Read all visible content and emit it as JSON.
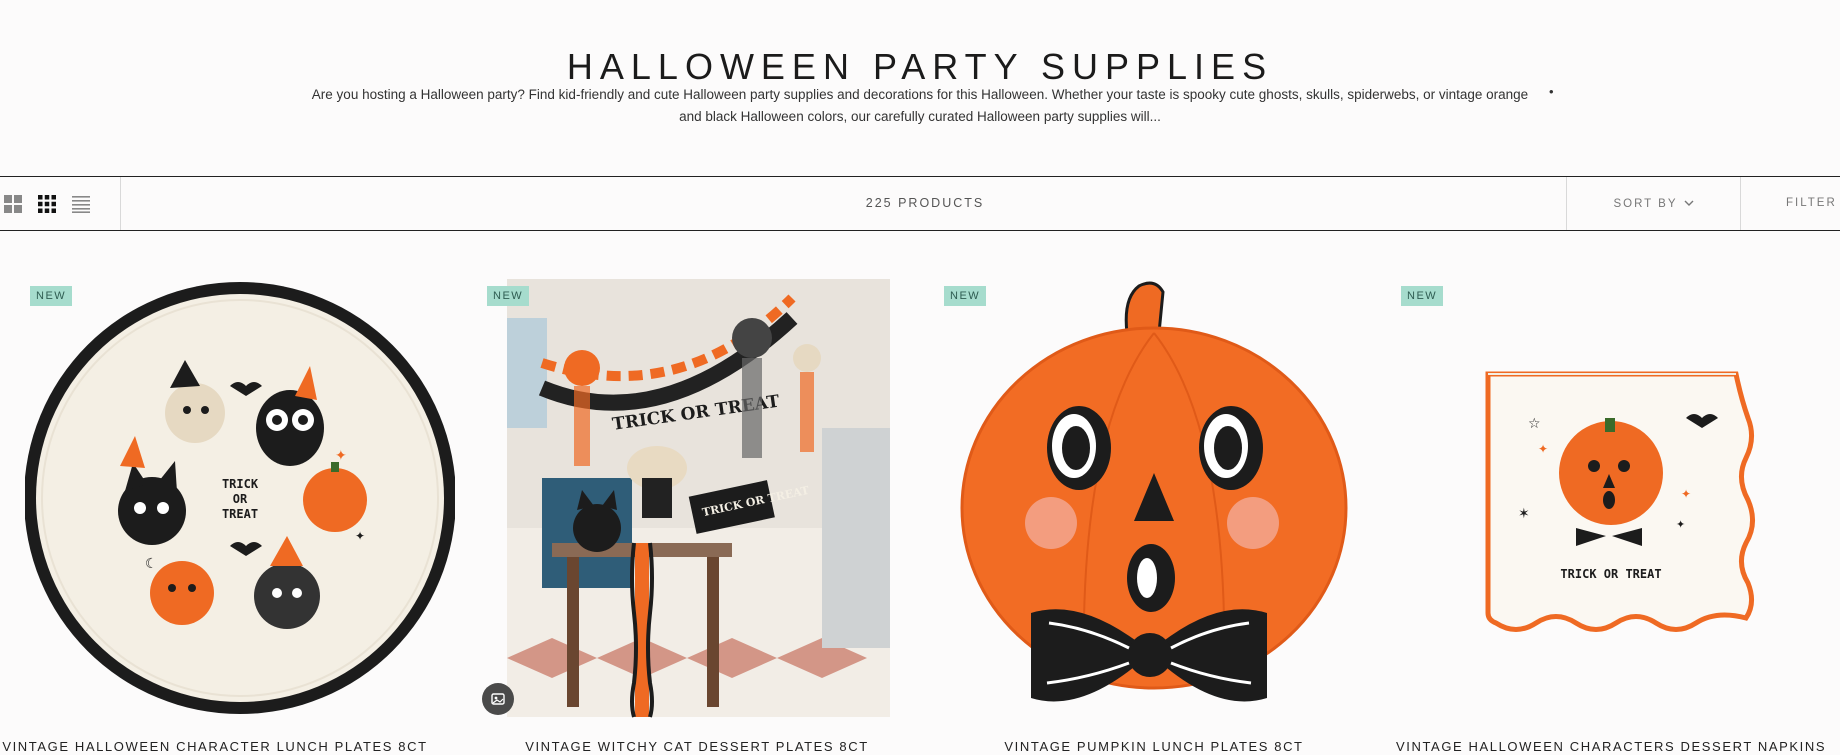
{
  "page": {
    "title": "HALLOWEEN PARTY SUPPLIES",
    "description": "Are you hosting a Halloween party? Find kid-friendly and cute Halloween party supplies and decorations for this Halloween. Whether your taste is spooky cute ghosts, skulls, spiderwebs, or vintage orange and black Halloween colors, our carefully curated Halloween party supplies will...",
    "more_marker": "•"
  },
  "toolbar": {
    "view_options": [
      "grid-large-icon",
      "grid-small-icon",
      "list-icon"
    ],
    "product_count": "225 PRODUCTS",
    "sort_label": "SORT BY",
    "filter_label": "FILTER"
  },
  "products": [
    {
      "badge": "NEW",
      "title": "VINTAGE HALLOWEEN CHARACTER LUNCH PLATES 8CT",
      "image": "character-plate-image"
    },
    {
      "badge": "NEW",
      "title": "VINTAGE WITCHY CAT DESSERT PLATES 8CT",
      "image": "kitchen-party-scene-image",
      "image_text": [
        "TRICK OR TREAT",
        "TRICK OR TREAT"
      ]
    },
    {
      "badge": "NEW",
      "title": "VINTAGE PUMPKIN LUNCH PLATES 8CT",
      "image": "pumpkin-plate-image"
    },
    {
      "badge": "NEW",
      "title": "VINTAGE HALLOWEEN CHARACTERS DESSERT NAPKINS",
      "image": "pumpkin-napkin-image",
      "image_text": [
        "TRICK OR TREAT"
      ]
    }
  ],
  "colors": {
    "badge": "#a6dccd",
    "orange": "#ef6a23",
    "black": "#1c1c1c",
    "cream": "#f4efe4"
  }
}
